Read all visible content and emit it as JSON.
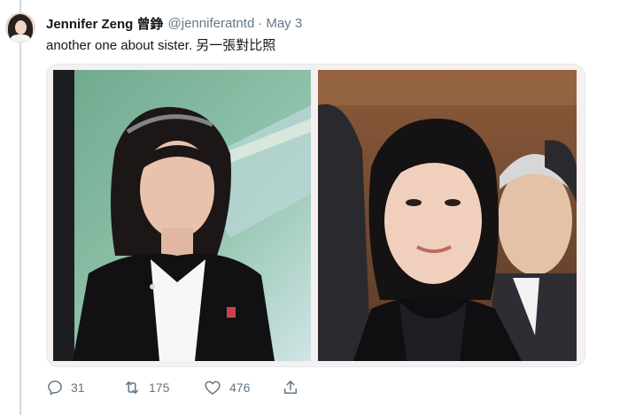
{
  "tweet": {
    "author": {
      "display_name": "Jennifer Zeng 曾錚",
      "handle": "@jenniferatntd",
      "separator": "·",
      "timestamp": "May 3",
      "avatar_icon": "user-avatar"
    },
    "text": "another one about sister. 另一張對比照",
    "media": {
      "photo_count": 2,
      "border_color": "#e1e8ed"
    },
    "actions": {
      "reply": {
        "icon": "reply-icon",
        "count": "31"
      },
      "retweet": {
        "icon": "retweet-icon",
        "count": "175"
      },
      "like": {
        "icon": "heart-icon",
        "count": "476"
      },
      "share": {
        "icon": "share-icon"
      }
    }
  },
  "colors": {
    "text_primary": "#14171a",
    "text_secondary": "#657786",
    "thread_line": "#cfd9de"
  }
}
